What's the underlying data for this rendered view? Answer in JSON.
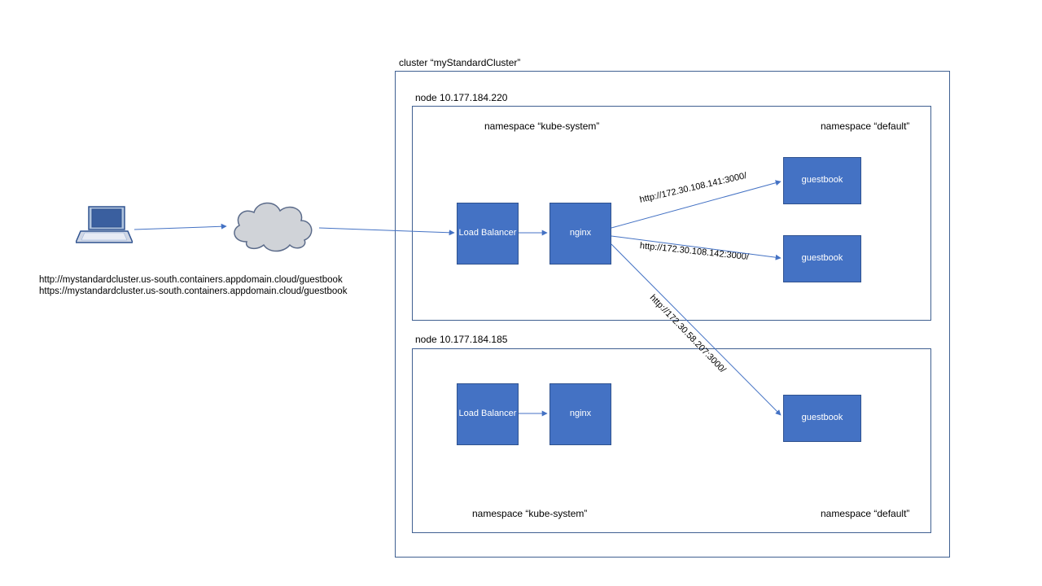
{
  "cluster": {
    "title": "cluster “myStandardCluster”"
  },
  "nodes": {
    "top": {
      "title": "node 10.177.184.220",
      "ns_left": "namespace “kube-system”",
      "ns_right": "namespace “default”",
      "lb": "Load Balancer",
      "nginx": "nginx",
      "guestbook1": "guestbook",
      "guestbook2": "guestbook"
    },
    "bottom": {
      "title": "node 10.177.184.185",
      "ns_left": "namespace “kube-system”",
      "ns_right": "namespace “default”",
      "lb": "Load Balancer",
      "nginx": "nginx",
      "guestbook": "guestbook"
    }
  },
  "urls": {
    "http": "http://mystandardcluster.us-south.containers.appdomain.cloud/guestbook",
    "https": "https://mystandardcluster.us-south.containers.appdomain.cloud/guestbook"
  },
  "edges": {
    "e1": "http://172.30.108.141:3000/",
    "e2": "http://172.30.108.142:3000/",
    "e3": "http://172.30.58.207:3000/"
  },
  "icons": {
    "laptop": "laptop-icon",
    "cloud": "cloud-icon"
  }
}
